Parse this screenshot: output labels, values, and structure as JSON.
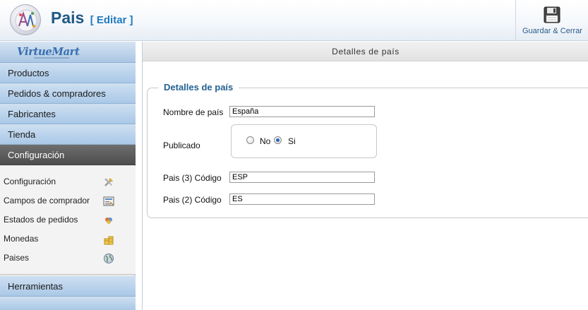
{
  "header": {
    "title": "Pais",
    "subtitle": "[ Editar ]",
    "logo_icon": "joomla-virtuemart-logo-icon",
    "save_button": {
      "label": "Guardar & Cerrar",
      "icon": "floppy-disk-icon"
    }
  },
  "sidebar": {
    "brand": "VirtueMart",
    "menu": [
      {
        "label": "Productos"
      },
      {
        "label": "Pedidos & compradores"
      },
      {
        "label": "Fabricantes"
      },
      {
        "label": "Tienda"
      },
      {
        "label": "Configuración",
        "active": true
      }
    ],
    "submenu": [
      {
        "label": "Configuración",
        "icon": "tools-icon"
      },
      {
        "label": "Campos de comprador",
        "icon": "form-fields-icon"
      },
      {
        "label": "Estados de pedidos",
        "icon": "order-status-icon"
      },
      {
        "label": "Monedas",
        "icon": "coins-icon"
      },
      {
        "label": "Paises",
        "icon": "globe-icon"
      }
    ],
    "tools": {
      "label": "Herramientas"
    }
  },
  "main": {
    "section_header": "Detalles de país",
    "fieldset_legend": "Detalles de país",
    "fields": {
      "country_name": {
        "label": "Nombre de país",
        "value": "España"
      },
      "published": {
        "label": "Publicado",
        "options": [
          {
            "label": "No",
            "checked": false
          },
          {
            "label": "Si",
            "checked": true
          }
        ]
      },
      "code3": {
        "label": "Pais (3) Código",
        "value": "ESP"
      },
      "code2": {
        "label": "Pais (2) Código",
        "value": "ES"
      }
    }
  },
  "colors": {
    "title": "#1f5a86",
    "subtitle": "#1f7ac0",
    "legend": "#236192",
    "menu_bg": "#a9c8e7",
    "menu_active_bg": "#4d4d4d"
  }
}
